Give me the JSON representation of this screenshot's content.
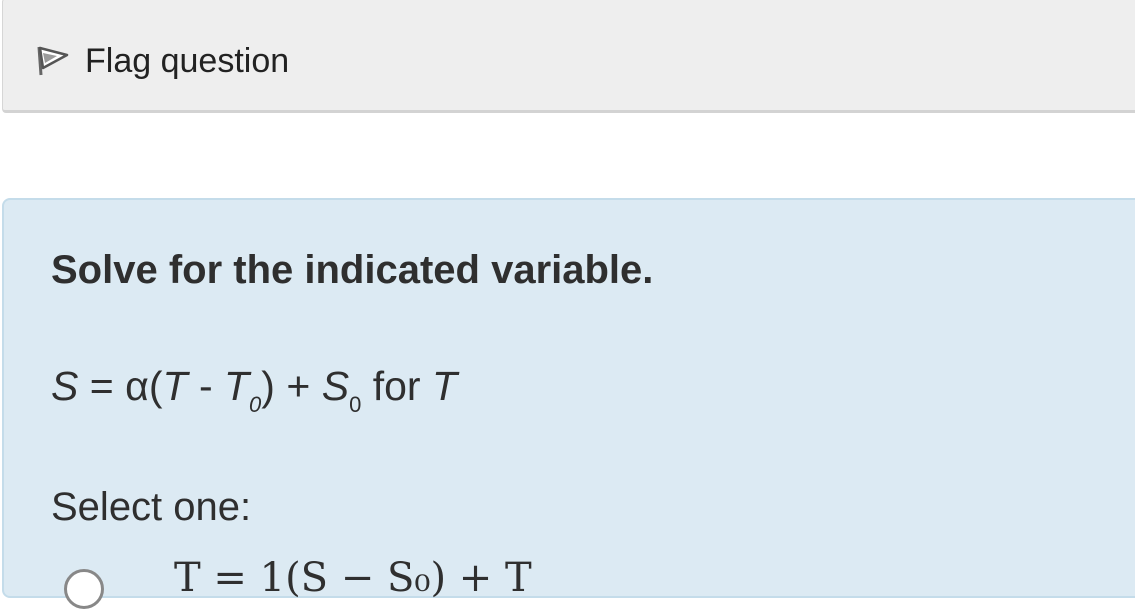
{
  "flag": {
    "label": "Flag question",
    "icon": "flag-outline-icon"
  },
  "question": {
    "prompt": "Solve for the indicated variable.",
    "equation": {
      "lhs": "S",
      "eq": "=",
      "alpha": "α",
      "open": "(",
      "T1": "T",
      "minus": "-",
      "T2": "T",
      "sub1": "0",
      "close": ")",
      "plus": "+",
      "S2": "S",
      "sub2": "0",
      "for_word": "for",
      "var": "T"
    },
    "select_label": "Select one:",
    "option_a": {
      "fragment": "T = 1(S − S₀) + T"
    }
  },
  "colors": {
    "flag_bar_bg": "#eeeeee",
    "question_bg": "#dceaf3",
    "question_border": "#c4dcea",
    "text": "#2f2f2f"
  }
}
